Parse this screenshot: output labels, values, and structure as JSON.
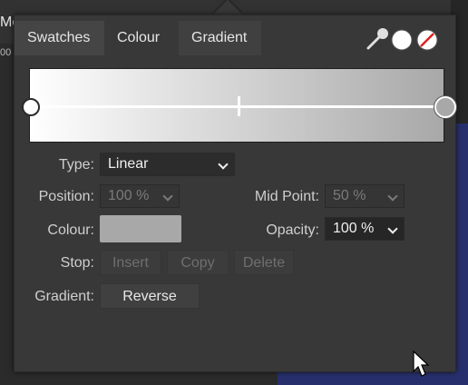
{
  "background": {
    "top_text": "Me",
    "ruler_text": "00"
  },
  "tabs": [
    {
      "label": "Swatches"
    },
    {
      "label": "Colour"
    },
    {
      "label": "Gradient"
    }
  ],
  "toolbar": {
    "picker_icon": "eyedropper-icon",
    "fill_icon": "white-fill-icon",
    "none_icon": "no-fill-icon"
  },
  "gradient": {
    "start_color": "#ffffff",
    "end_color": "#a8a8a8",
    "mid_point_fraction": 0.5
  },
  "fields": {
    "type_label": "Type:",
    "type_value": "Linear",
    "position_label": "Position:",
    "position_value": "100 %",
    "midpoint_label": "Mid Point:",
    "midpoint_value": "50 %",
    "colour_label": "Colour:",
    "colour_value": "#a8a8a8",
    "opacity_label": "Opacity:",
    "opacity_value": "100 %",
    "stop_label": "Stop:",
    "gradient_label": "Gradient:"
  },
  "buttons": {
    "insert": "Insert",
    "copy": "Copy",
    "delete": "Delete",
    "reverse": "Reverse"
  }
}
